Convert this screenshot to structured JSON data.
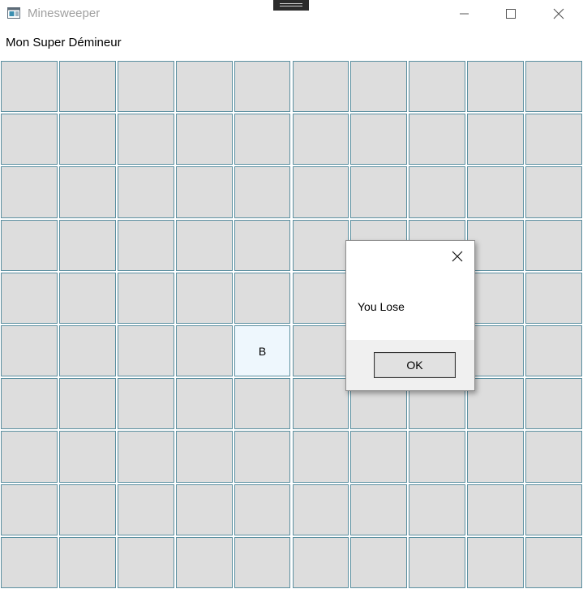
{
  "window": {
    "title": "Minesweeper"
  },
  "app": {
    "heading": "Mon Super Démineur"
  },
  "board": {
    "rows": 10,
    "cols": 10,
    "revealed": [
      {
        "row": 5,
        "col": 4,
        "label": "B"
      }
    ],
    "colors": {
      "cell": "#dddddd",
      "border": "#5a8fa0",
      "revealed": "#eef7fd"
    }
  },
  "dialog": {
    "message": "You Lose",
    "ok_label": "OK"
  }
}
